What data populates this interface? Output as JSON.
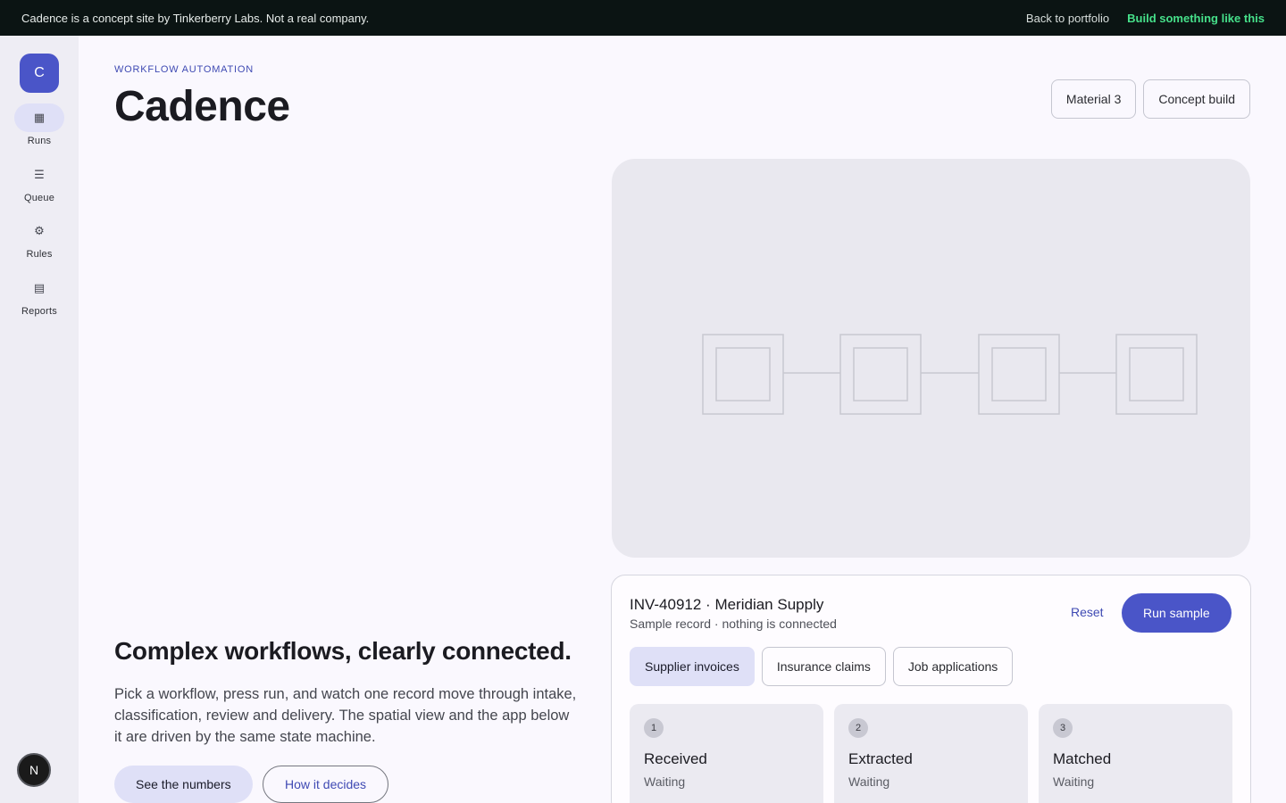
{
  "banner": {
    "notice": "Cadence is a concept site by Tinkerberry Labs. Not a real company.",
    "back_link": "Back to portfolio",
    "cta_link": "Build something like this"
  },
  "rail": {
    "fab_letter": "C",
    "items": [
      {
        "label": "Runs",
        "icon": "grid-icon",
        "glyph": "▦"
      },
      {
        "label": "Queue",
        "icon": "list-icon",
        "glyph": "☰"
      },
      {
        "label": "Rules",
        "icon": "gear-icon",
        "glyph": "⚙"
      },
      {
        "label": "Reports",
        "icon": "report-icon",
        "glyph": "▤"
      }
    ],
    "avatar_letter": "N"
  },
  "header": {
    "eyebrow": "WORKFLOW AUTOMATION",
    "title": "Cadence",
    "chips": [
      "Material 3",
      "Concept build"
    ]
  },
  "hero": {
    "headline": "Complex workflows, clearly connected.",
    "body": "Pick a workflow, press run, and watch one record move through intake, classification, review and delivery. The spatial view and the app below it are driven by the same state machine.",
    "primary_button": "See the numbers",
    "secondary_button": "How it decides"
  },
  "record": {
    "title": "INV-40912 · Meridian Supply",
    "subtitle": "Sample record · nothing is connected",
    "reset_label": "Reset",
    "run_label": "Run sample",
    "workflows": [
      {
        "label": "Supplier invoices",
        "selected": true
      },
      {
        "label": "Insurance claims",
        "selected": false
      },
      {
        "label": "Job applications",
        "selected": false
      }
    ],
    "steps": [
      {
        "number": "1",
        "name": "Received",
        "state": "Waiting"
      },
      {
        "number": "2",
        "name": "Extracted",
        "state": "Waiting"
      },
      {
        "number": "3",
        "name": "Matched",
        "state": "Waiting"
      }
    ]
  },
  "colors": {
    "primary": "#4a55c8",
    "tonal": "#dfe0f7",
    "banner_bg": "#0b1413",
    "banner_cta": "#46e08a"
  }
}
